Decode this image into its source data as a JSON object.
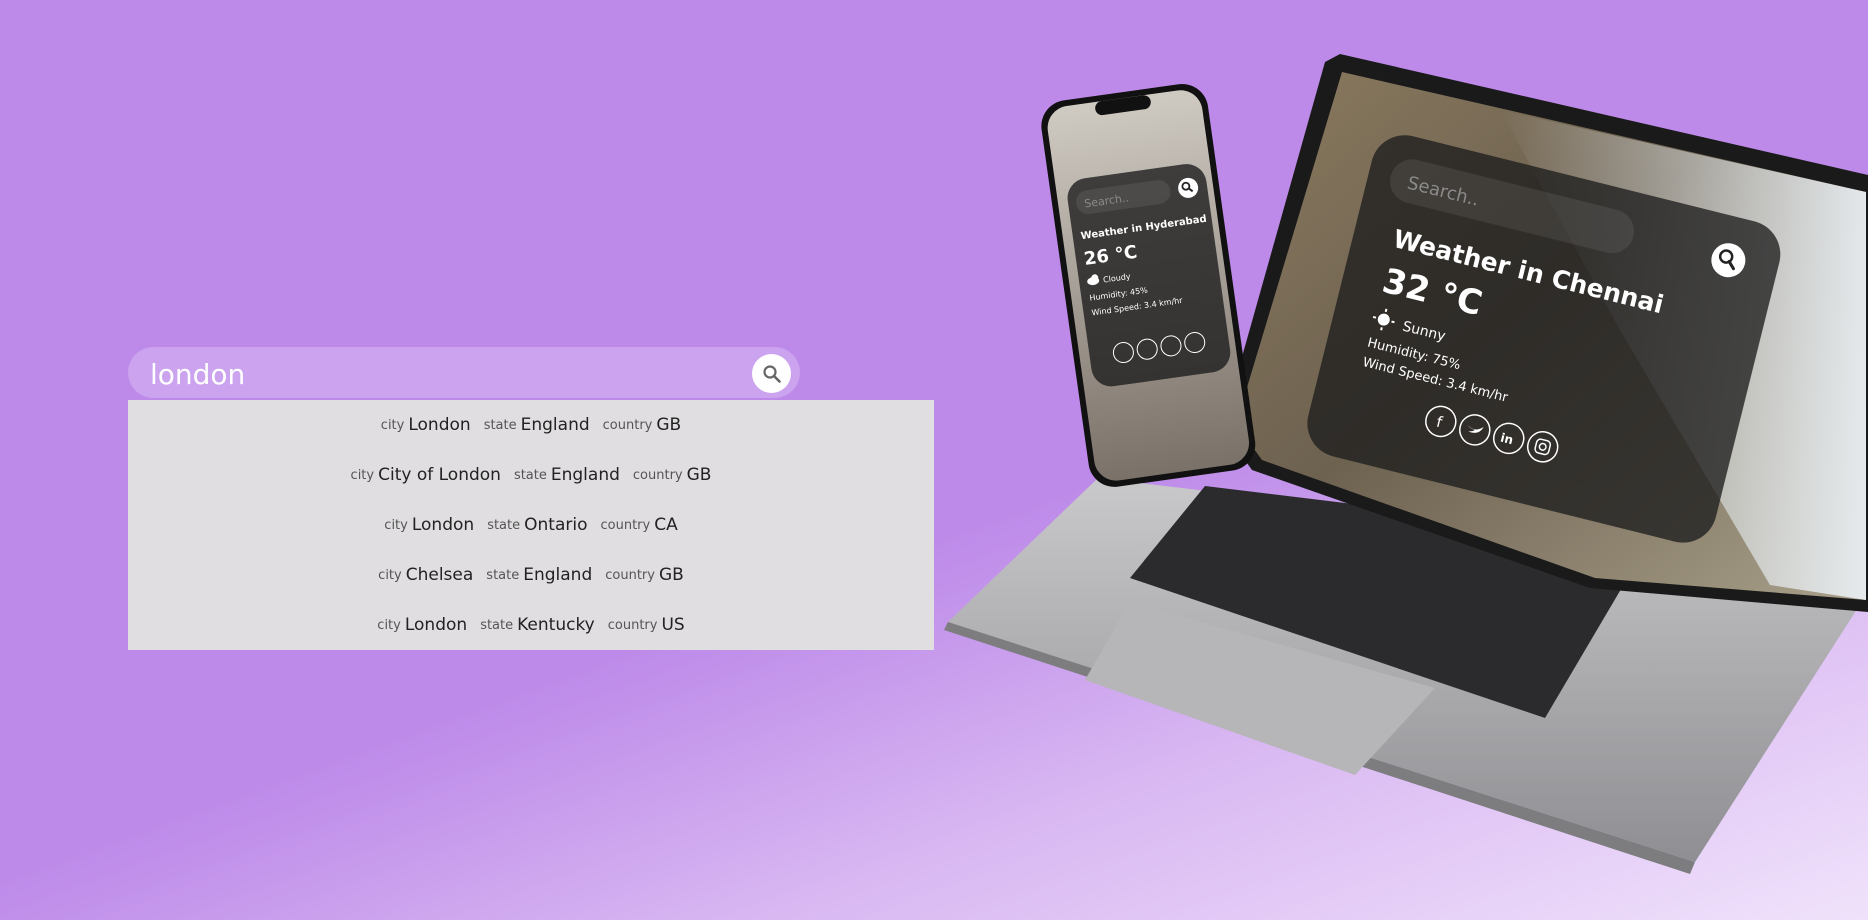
{
  "search": {
    "value": "london",
    "placeholder": ""
  },
  "suggestions": [
    {
      "city_label": "city",
      "city": "London",
      "state_label": "state",
      "state": "England",
      "country_label": "country",
      "country": "GB"
    },
    {
      "city_label": "city",
      "city": "City of London",
      "state_label": "state",
      "state": "England",
      "country_label": "country",
      "country": "GB"
    },
    {
      "city_label": "city",
      "city": "London",
      "state_label": "state",
      "state": "Ontario",
      "country_label": "country",
      "country": "CA"
    },
    {
      "city_label": "city",
      "city": "Chelsea",
      "state_label": "state",
      "state": "England",
      "country_label": "country",
      "country": "GB"
    },
    {
      "city_label": "city",
      "city": "London",
      "state_label": "state",
      "state": "Kentucky",
      "country_label": "country",
      "country": "US"
    }
  ],
  "laptop_card": {
    "search_placeholder": "Search..",
    "title": "Weather in Chennai",
    "temp": "32 °C",
    "condition": "Sunny",
    "humidity": "Humidity: 75%",
    "wind": "Wind Speed: 3.4 km/hr"
  },
  "phone_card": {
    "search_placeholder": "Search..",
    "title": "Weather in Hyderabad",
    "temp": "26 °C",
    "condition": "Cloudy",
    "humidity": "Humidity: 45%",
    "wind": "Wind Speed: 3.4 km/hr"
  },
  "icons": [
    "search-icon",
    "facebook-icon",
    "twitter-icon",
    "linkedin-icon",
    "instagram-icon",
    "sun-icon",
    "cloud-icon"
  ],
  "colors": {
    "background": "#bd8ae9",
    "suggestion_bg": "#e0dee0",
    "card": "#1e1e1e"
  }
}
